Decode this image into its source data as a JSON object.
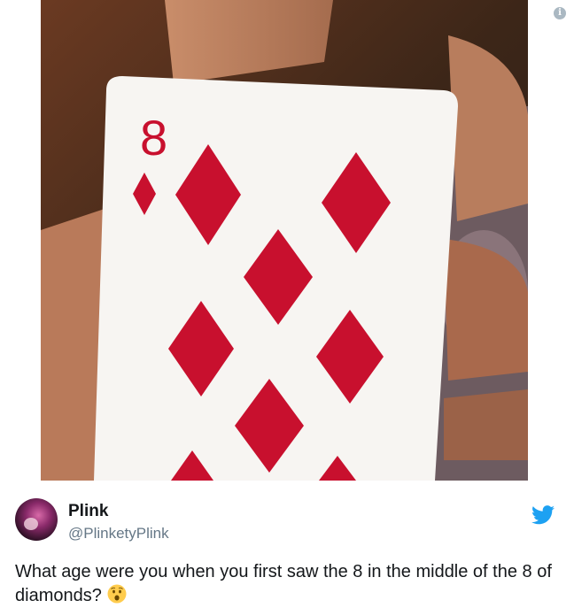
{
  "tweet": {
    "display_name": "Plink",
    "handle": "@PlinketyPlink",
    "text": "What age were you when you first saw the 8 in the middle of the 8 of diamonds?",
    "emoji": "astonished-face-emoji"
  },
  "card": {
    "rank": "8",
    "suit": "diamonds"
  },
  "icons": {
    "info": "info-icon",
    "platform": "twitter-bird-icon"
  },
  "colors": {
    "suit_red": "#c8102e",
    "twitter_blue": "#1da1f2",
    "handle_gray": "#657786"
  }
}
